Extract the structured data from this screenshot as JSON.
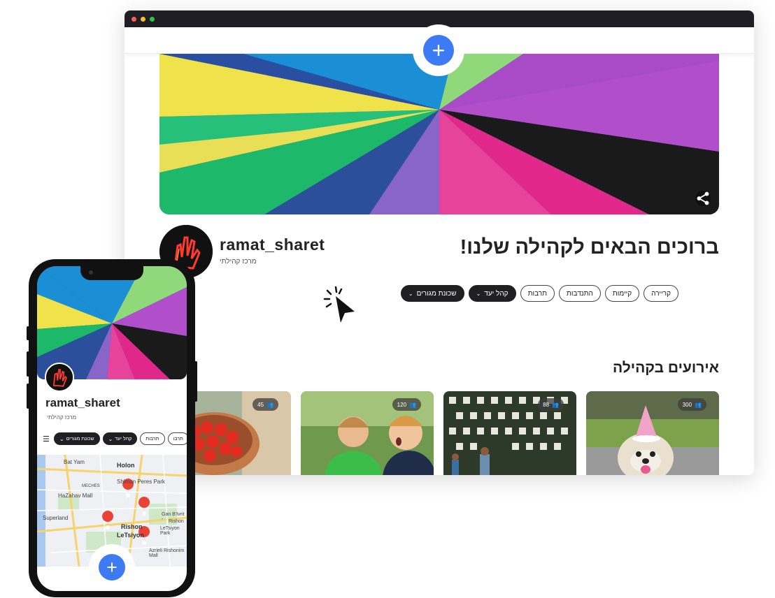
{
  "desktop": {
    "username": "ramat_sharet",
    "subtitle": "מרכז קהילתי",
    "welcome": "ברוכים הבאים לקהילה שלנו!",
    "add_symbol": "+",
    "chips": [
      {
        "label": "שכונת מגורים",
        "dropdown": true,
        "selected": true
      },
      {
        "label": "קהל יעד",
        "dropdown": true,
        "selected": true
      },
      {
        "label": "תרבות",
        "dropdown": false,
        "selected": false
      },
      {
        "label": "התנדבות",
        "dropdown": false,
        "selected": false
      },
      {
        "label": "קיימות",
        "dropdown": false,
        "selected": false
      },
      {
        "label": "קריירה",
        "dropdown": false,
        "selected": false
      }
    ],
    "events_title": "אירועים בקהילה",
    "events": [
      {
        "count": "300",
        "image": "dog-party"
      },
      {
        "count": "88",
        "image": "plant-wall"
      },
      {
        "count": "120",
        "image": "kids"
      },
      {
        "count": "45",
        "image": "tomatoes"
      }
    ]
  },
  "mobile": {
    "username": "ramat_sharet",
    "subtitle": "מרכז קהילתי",
    "add_symbol": "+",
    "chips": [
      {
        "label": "שכונת מגורים",
        "dropdown": true,
        "selected": true
      },
      {
        "label": "קהל יעד",
        "dropdown": true,
        "selected": true
      },
      {
        "label": "תרבות",
        "dropdown": false,
        "selected": false
      },
      {
        "label": "תרבו",
        "dropdown": false,
        "selected": false
      }
    ],
    "map_labels": {
      "bat_yam": "Bat Yam",
      "holon": "Holon",
      "shimon": "Shimon Peres Park",
      "hazahav": "HaZahav Mall",
      "meches": "MECHES",
      "superland": "Superland",
      "gan": "Gan B'Ivrit -",
      "rishon_park": "Rishon",
      "rishon_park2": "LeTsiyon Park",
      "rishon": "Rishon",
      "letsiyon": "LeTsiyon",
      "azrieli": "Azrieli Rishonim Mall"
    }
  },
  "colors": {
    "accent": "#3d7bf5",
    "chip_dark": "#1f1f24",
    "marker": "#ea4335"
  }
}
